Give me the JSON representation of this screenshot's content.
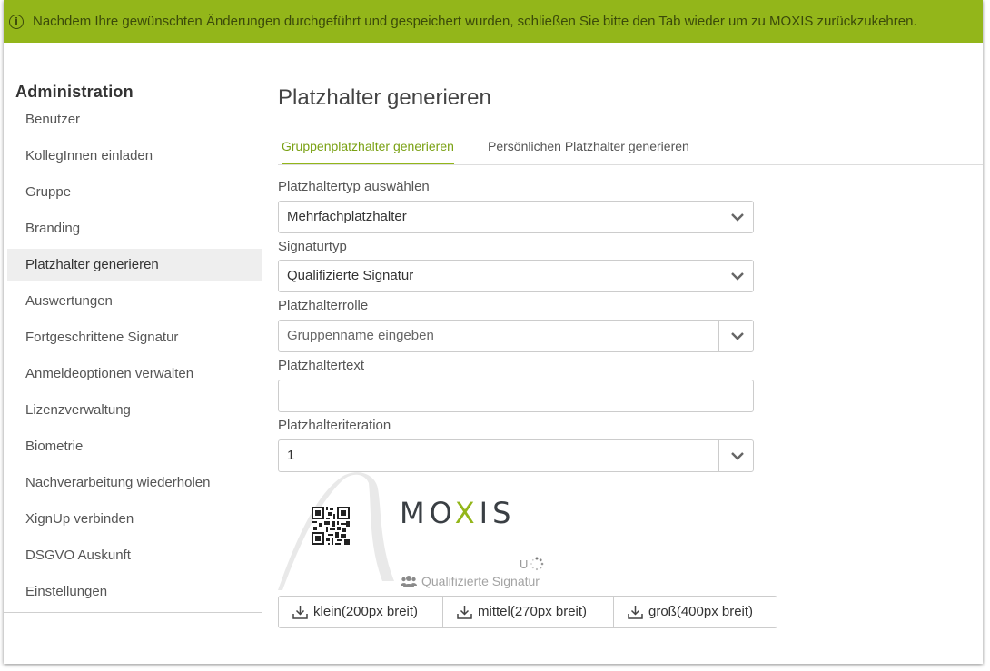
{
  "banner": {
    "icon": "info-icon",
    "text": "Nachdem Ihre gewünschten Änderungen durchgeführt und gespeichert wurden, schließen Sie bitte den Tab wieder um zu MOXIS zurückzukehren."
  },
  "sidebar": {
    "heading": "Administration",
    "items": [
      {
        "label": "Benutzer"
      },
      {
        "label": "KollegInnen einladen"
      },
      {
        "label": "Gruppe"
      },
      {
        "label": "Branding"
      },
      {
        "label": "Platzhalter generieren",
        "active": true
      },
      {
        "label": "Auswertungen"
      },
      {
        "label": "Fortgeschrittene Signatur"
      },
      {
        "label": "Anmeldeoptionen verwalten"
      },
      {
        "label": "Lizenzverwaltung"
      },
      {
        "label": "Biometrie"
      },
      {
        "label": "Nachverarbeitung wiederholen"
      },
      {
        "label": "XignUp verbinden"
      },
      {
        "label": "DSGVO Auskunft"
      },
      {
        "label": "Einstellungen"
      }
    ]
  },
  "main": {
    "title": "Platzhalter generieren",
    "tabs": [
      {
        "label": "Gruppenplatzhalter generieren",
        "active": true
      },
      {
        "label": "Persönlichen Platzhalter generieren"
      }
    ],
    "form": {
      "type_label": "Platzhaltertyp auswählen",
      "type_value": "Mehrfachplatzhalter",
      "signature_label": "Signaturtyp",
      "signature_value": "Qualifizierte Signatur",
      "role_label": "Platzhalterrolle",
      "role_placeholder": "Gruppenname eingeben",
      "text_label": "Platzhaltertext",
      "text_value": "",
      "iteration_label": "Platzhalteriteration",
      "iteration_value": "1"
    },
    "preview": {
      "logo_text": "MOXIS",
      "initial": "U",
      "signature_type": "Qualifizierte Signatur"
    },
    "downloads": [
      {
        "label": "klein(200px breit)"
      },
      {
        "label": "mittel(270px breit)"
      },
      {
        "label": "groß(400px breit)"
      }
    ]
  },
  "colors": {
    "accent": "#93b61a",
    "accent_text": "#7aa114"
  }
}
